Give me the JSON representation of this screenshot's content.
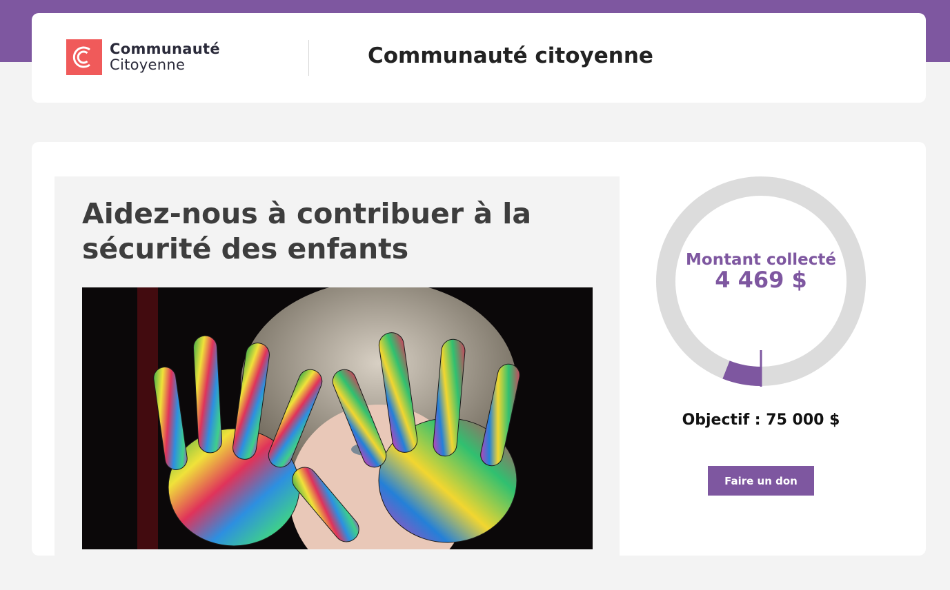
{
  "header": {
    "logo_line1": "Communauté",
    "logo_line2": "Citoyenne",
    "site_title": "Communauté citoyenne"
  },
  "campaign": {
    "title": "Aidez-nous à contribuer à la sécurité des enfants",
    "image_icon": "child-hands-painted-photo"
  },
  "progress": {
    "collected_label": "Montant collecté",
    "collected_amount": "4 469 $",
    "goal_text": "Objectif : 75 000 $",
    "fraction": 0.0596
  },
  "actions": {
    "donate_label": "Faire un don"
  },
  "colors": {
    "accent": "#7e57a0",
    "logo": "#f05a5a",
    "ring_track": "#dcdcdc"
  }
}
